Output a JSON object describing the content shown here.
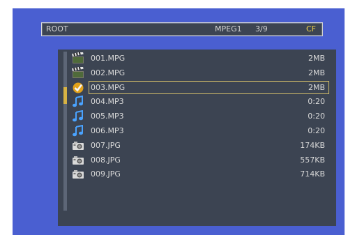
{
  "header": {
    "path": "ROOT",
    "filter": "MPEG1",
    "position": "3/9",
    "media": "CF"
  },
  "files": [
    {
      "icon": "film-clapper-icon",
      "name": "001.MPG",
      "size": "2MB",
      "selected": false
    },
    {
      "icon": "film-clapper-icon",
      "name": "002.MPG",
      "size": "2MB",
      "selected": false
    },
    {
      "icon": "check-mark-icon",
      "name": "003.MPG",
      "size": "2MB",
      "selected": true
    },
    {
      "icon": "music-note-icon",
      "name": "004.MP3",
      "size": "0:20",
      "selected": false
    },
    {
      "icon": "music-note-icon",
      "name": "005.MP3",
      "size": "0:20",
      "selected": false
    },
    {
      "icon": "music-note-icon",
      "name": "006.MP3",
      "size": "0:20",
      "selected": false
    },
    {
      "icon": "camera-icon",
      "name": "007.JPG",
      "size": "174KB",
      "selected": false
    },
    {
      "icon": "camera-icon",
      "name": "008.JPG",
      "size": "557KB",
      "selected": false
    },
    {
      "icon": "camera-icon",
      "name": "009.JPG",
      "size": "714KB",
      "selected": false
    }
  ],
  "colors": {
    "outer_background": "#4a5fd1",
    "panel_background": "#3c4452",
    "text": "#d8d8d8",
    "accent": "#f0d24a",
    "selection_border": "#d6c06a"
  }
}
